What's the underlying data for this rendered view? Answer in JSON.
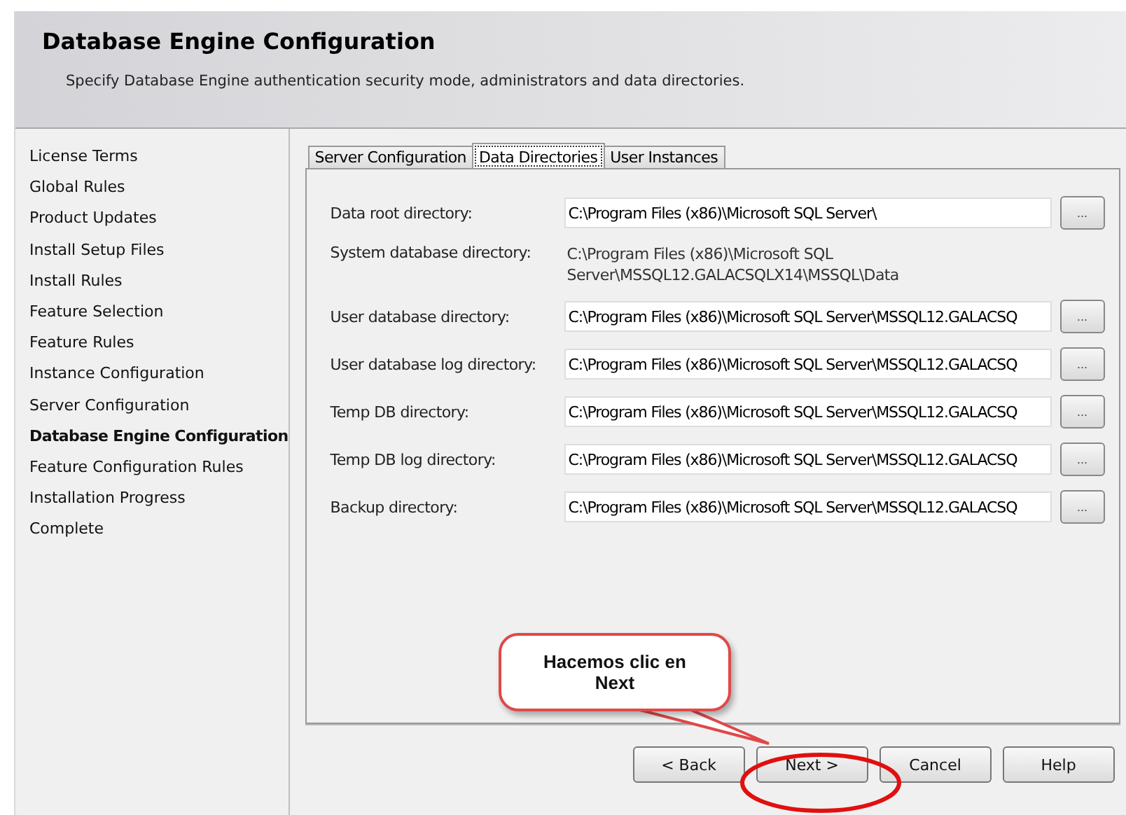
{
  "header": {
    "title": "Database Engine Configuration",
    "subtitle": "Specify Database Engine authentication security mode, administrators and data directories."
  },
  "steps": [
    {
      "label": "License Terms",
      "selected": false
    },
    {
      "label": "Global Rules",
      "selected": false
    },
    {
      "label": "Product Updates",
      "selected": false
    },
    {
      "label": "Install Setup Files",
      "selected": false
    },
    {
      "label": "Install Rules",
      "selected": false
    },
    {
      "label": "Feature Selection",
      "selected": false
    },
    {
      "label": "Feature Rules",
      "selected": false
    },
    {
      "label": "Instance Configuration",
      "selected": false
    },
    {
      "label": "Server Configuration",
      "selected": false
    },
    {
      "label": "Database Engine Configuration",
      "selected": true
    },
    {
      "label": "Feature Configuration Rules",
      "selected": false
    },
    {
      "label": "Installation Progress",
      "selected": false
    },
    {
      "label": "Complete",
      "selected": false
    }
  ],
  "tabs": [
    {
      "label": "Server Configuration",
      "selected": false
    },
    {
      "label": "Data Directories",
      "selected": true
    },
    {
      "label": "User Instances",
      "selected": false
    }
  ],
  "directories": [
    {
      "kind": "field",
      "label": "Data root directory:",
      "value": "C:\\Program Files (x86)\\Microsoft SQL Server\\",
      "browse": "..."
    },
    {
      "kind": "text",
      "label": "System database directory:",
      "value": "C:\\Program Files (x86)\\Microsoft SQL Server\\MSSQL12.GALACSQLX14\\MSSQL\\Data"
    },
    {
      "kind": "field",
      "label": "User database directory:",
      "value": "C:\\Program Files (x86)\\Microsoft SQL Server\\MSSQL12.GALACSQ",
      "browse": "..."
    },
    {
      "kind": "field",
      "label": "User database log directory:",
      "value": "C:\\Program Files (x86)\\Microsoft SQL Server\\MSSQL12.GALACSQ",
      "browse": "..."
    },
    {
      "kind": "field",
      "label": "Temp DB directory:",
      "value": "C:\\Program Files (x86)\\Microsoft SQL Server\\MSSQL12.GALACSQ",
      "browse": "..."
    },
    {
      "kind": "field",
      "label": "Temp DB log directory:",
      "value": "C:\\Program Files (x86)\\Microsoft SQL Server\\MSSQL12.GALACSQ",
      "browse": "..."
    },
    {
      "kind": "field",
      "label": "Backup directory:",
      "value": "C:\\Program Files (x86)\\Microsoft SQL Server\\MSSQL12.GALACSQ",
      "browse": "..."
    }
  ],
  "buttons": [
    "< Back",
    "Next >",
    "Cancel",
    "Help"
  ],
  "callout": {
    "text": "Hacemos clic en Next"
  }
}
